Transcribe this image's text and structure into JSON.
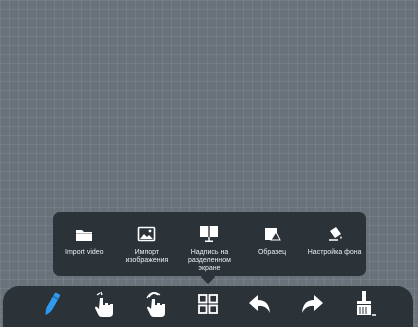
{
  "popup_menu": {
    "items": [
      {
        "label": "Import video",
        "icon": "folder-icon"
      },
      {
        "label": "Импорт изображения",
        "icon": "image-icon"
      },
      {
        "label": "Надпись на разделенном экране",
        "icon": "split-screen-board-icon"
      },
      {
        "label": "Образец",
        "icon": "shape-sample-icon"
      },
      {
        "label": "Настройка фона",
        "icon": "paint-bucket-icon"
      }
    ]
  },
  "toolbar": {
    "tools": [
      {
        "name": "pen-tool",
        "icon": "pen-icon",
        "active": true,
        "accent": "#2f9bf0"
      },
      {
        "name": "single-touch-tool",
        "icon": "hand-pointer-icon"
      },
      {
        "name": "multi-touch-tool",
        "icon": "hand-multi-touch-icon"
      },
      {
        "name": "more-tools",
        "icon": "grid-icon"
      },
      {
        "name": "undo",
        "icon": "undo-arrow-icon"
      },
      {
        "name": "redo",
        "icon": "redo-arrow-icon"
      },
      {
        "name": "clear-board",
        "icon": "broom-icon"
      }
    ]
  },
  "colors": {
    "canvas_background": "#69727a",
    "panel_background": "#2b3238",
    "accent": "#2f9bf0",
    "icon": "#ffffff"
  }
}
